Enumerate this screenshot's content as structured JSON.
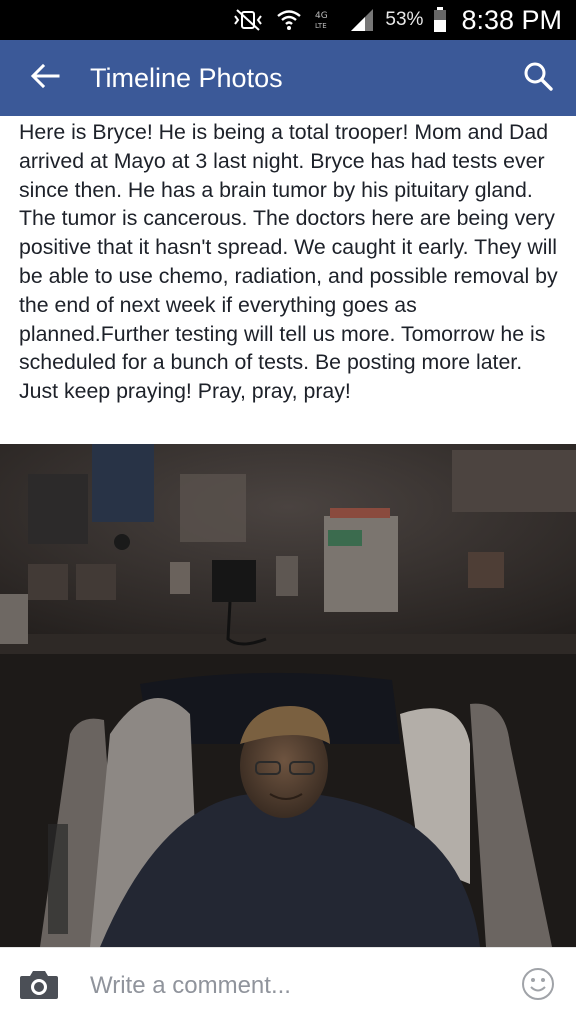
{
  "status_bar": {
    "battery_percent": "53%",
    "time": "8:38 PM",
    "icons": [
      "vibrate-mute-icon",
      "wifi-icon",
      "4g-lte-icon",
      "signal-bars-icon",
      "battery-icon"
    ]
  },
  "app_bar": {
    "title": "Timeline Photos",
    "back_icon": "arrow-left-icon",
    "search_icon": "search-icon",
    "background_color": "#3b5998"
  },
  "post": {
    "text": "Here is Bryce! He is being a total trooper! Mom and Dad arrived at Mayo at 3 last night. Bryce has had tests ever since then. He has a brain tumor by his pituitary gland. The tumor is cancerous. The doctors here are being very positive that it hasn't spread. We caught it early. They will be able to use chemo, radiation, and possible removal by the end of next week if everything goes as planned.Further testing will tell us more. Tomorrow he is scheduled for a bunch of tests. Be posting more later. Just keep praying! Pray, pray, pray!"
  },
  "photo": {
    "subject": "boy in hospital bed"
  },
  "comment_bar": {
    "placeholder": "Write a comment...",
    "camera_icon": "camera-icon",
    "emoji_icon": "smiley-icon"
  }
}
